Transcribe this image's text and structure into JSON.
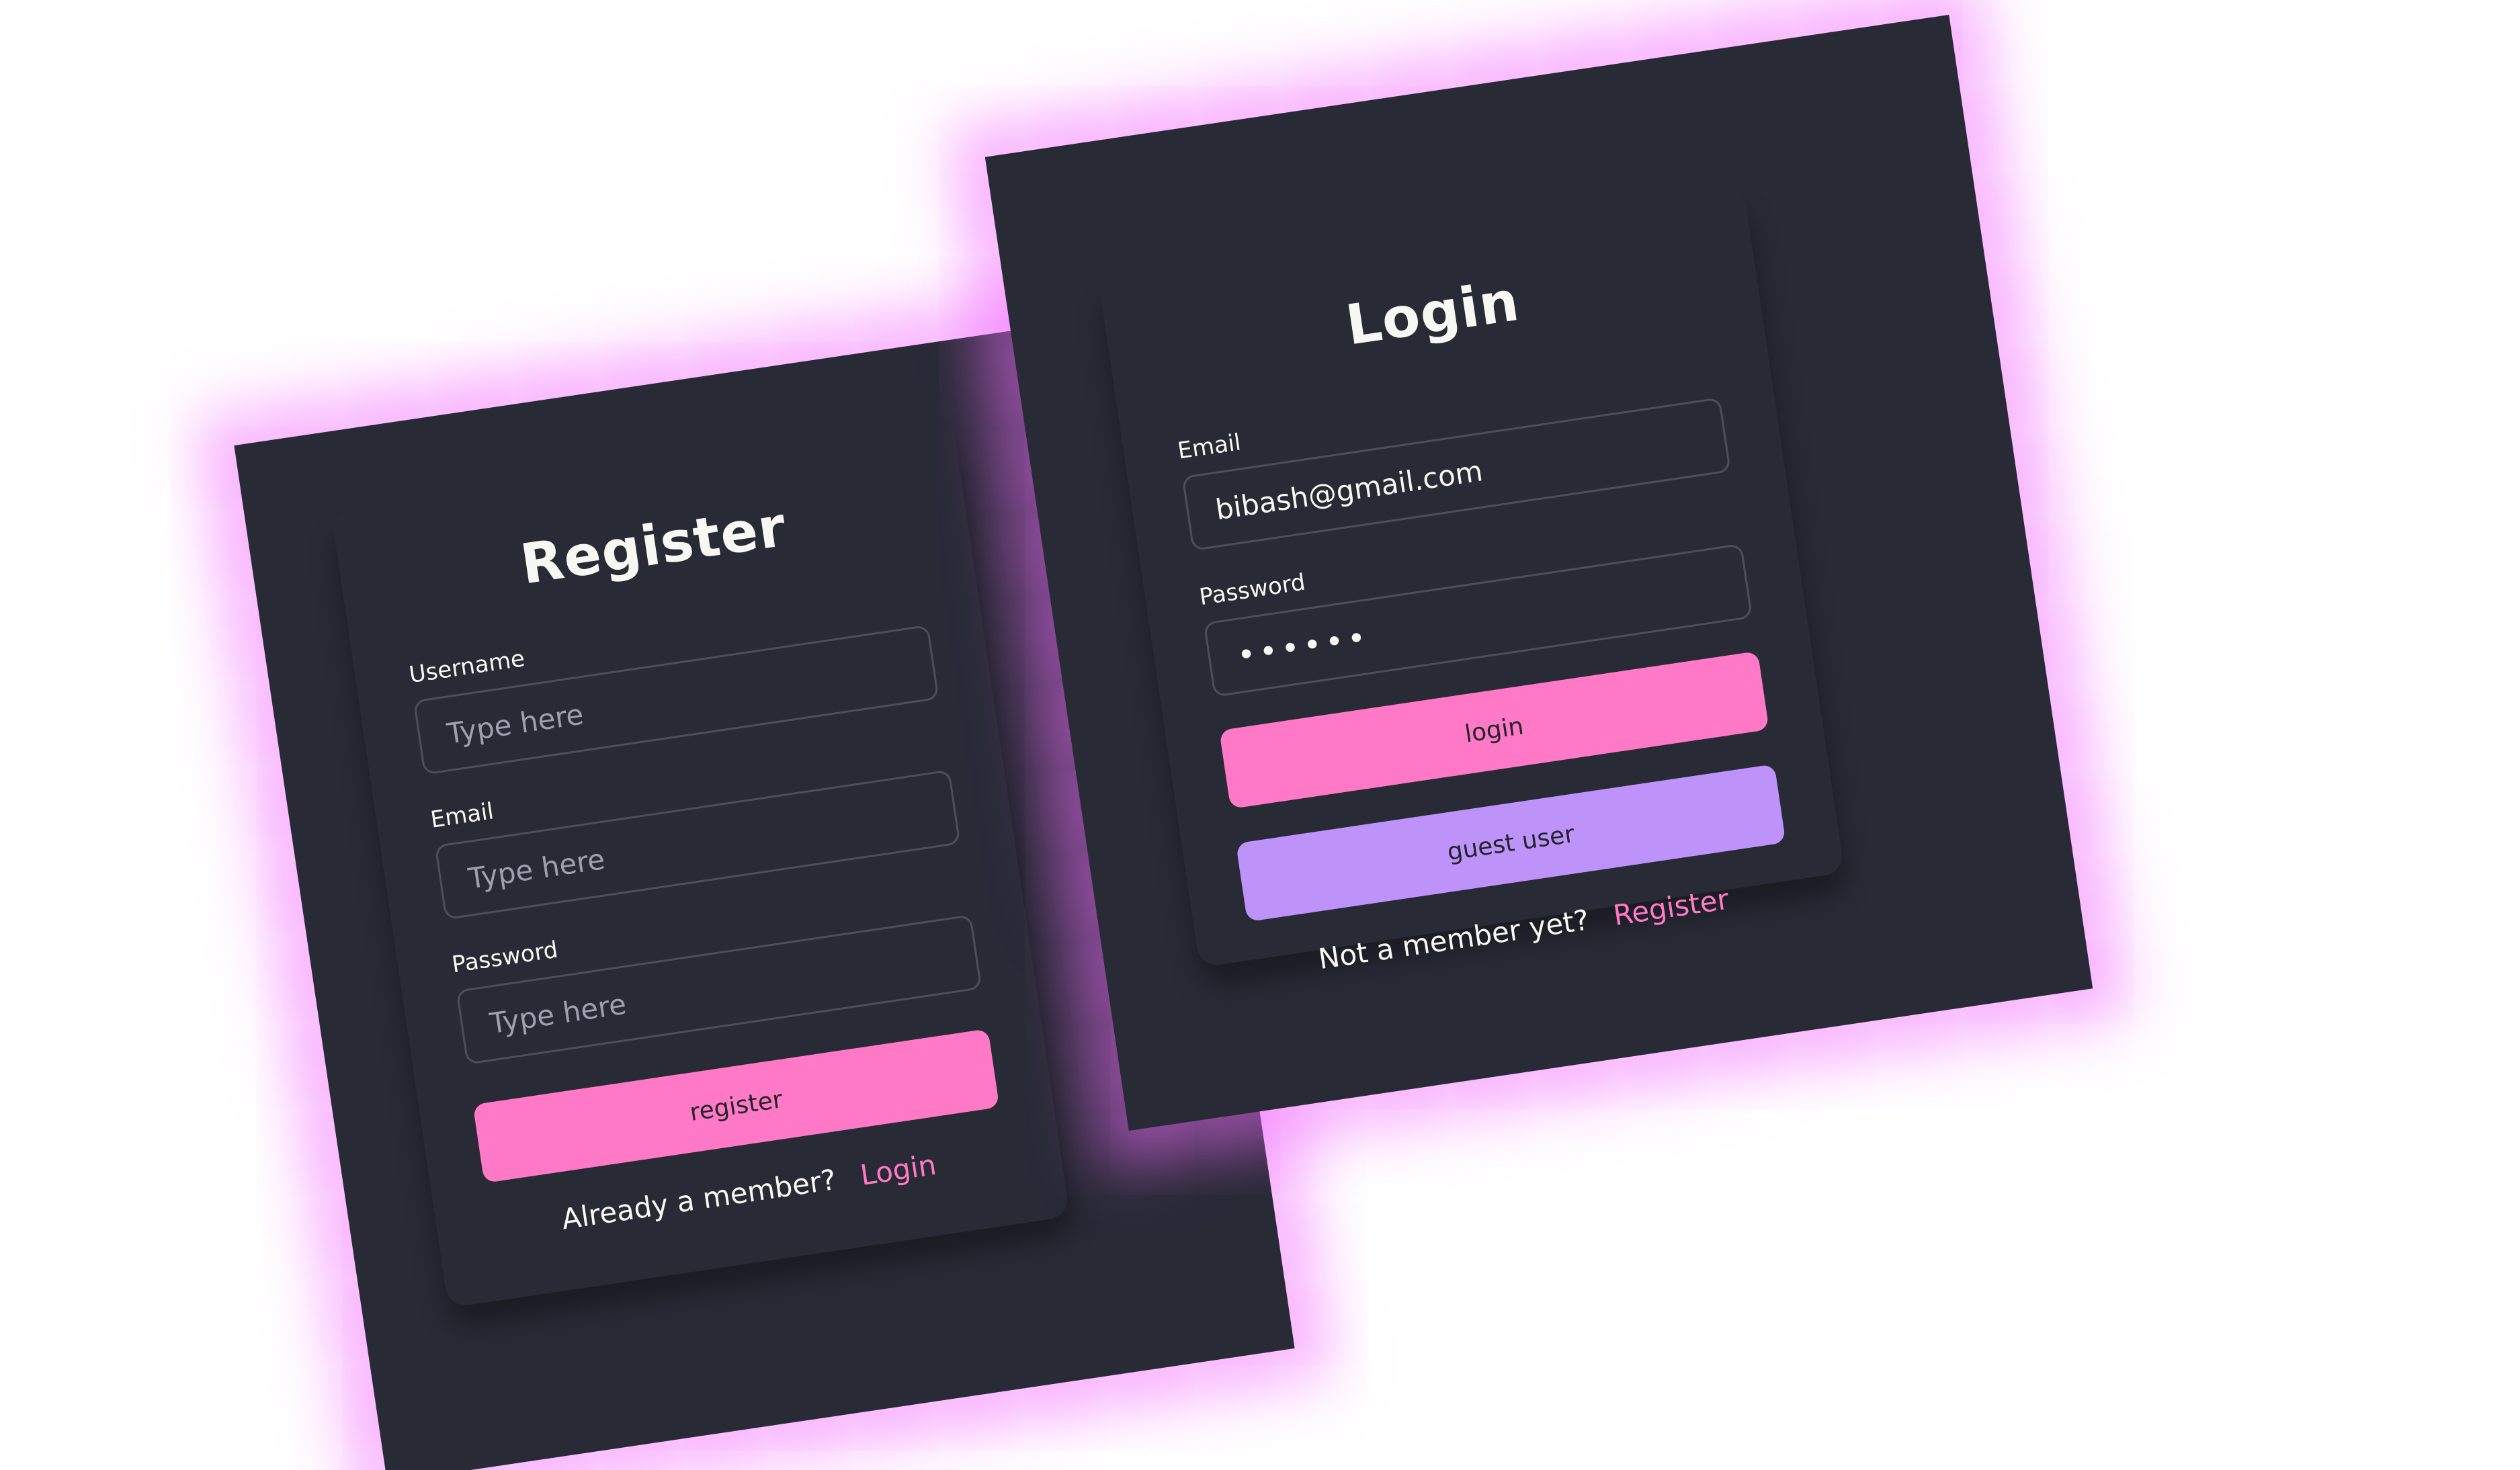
{
  "colors": {
    "background": "#282a36",
    "glow": "#f26eff",
    "primary_button": "#ff79c6",
    "secondary_button": "#bd93f9",
    "link": "#ff79c6",
    "text": "#f8f8f2"
  },
  "register": {
    "title": "Register",
    "fields": [
      {
        "label": "Username",
        "placeholder": "Type here",
        "value": ""
      },
      {
        "label": "Email",
        "placeholder": "Type here",
        "value": ""
      },
      {
        "label": "Password",
        "placeholder": "Type here",
        "value": ""
      }
    ],
    "submit_label": "register",
    "footer_text": "Already a member?",
    "footer_link": "Login"
  },
  "login": {
    "title": "Login",
    "fields": [
      {
        "label": "Email",
        "placeholder": "",
        "value": "bibash@gmail.com"
      },
      {
        "label": "Password",
        "placeholder": "",
        "value": "••••••"
      }
    ],
    "submit_label": "login",
    "guest_label": "guest user",
    "footer_text": "Not a member yet?",
    "footer_link": "Register"
  }
}
